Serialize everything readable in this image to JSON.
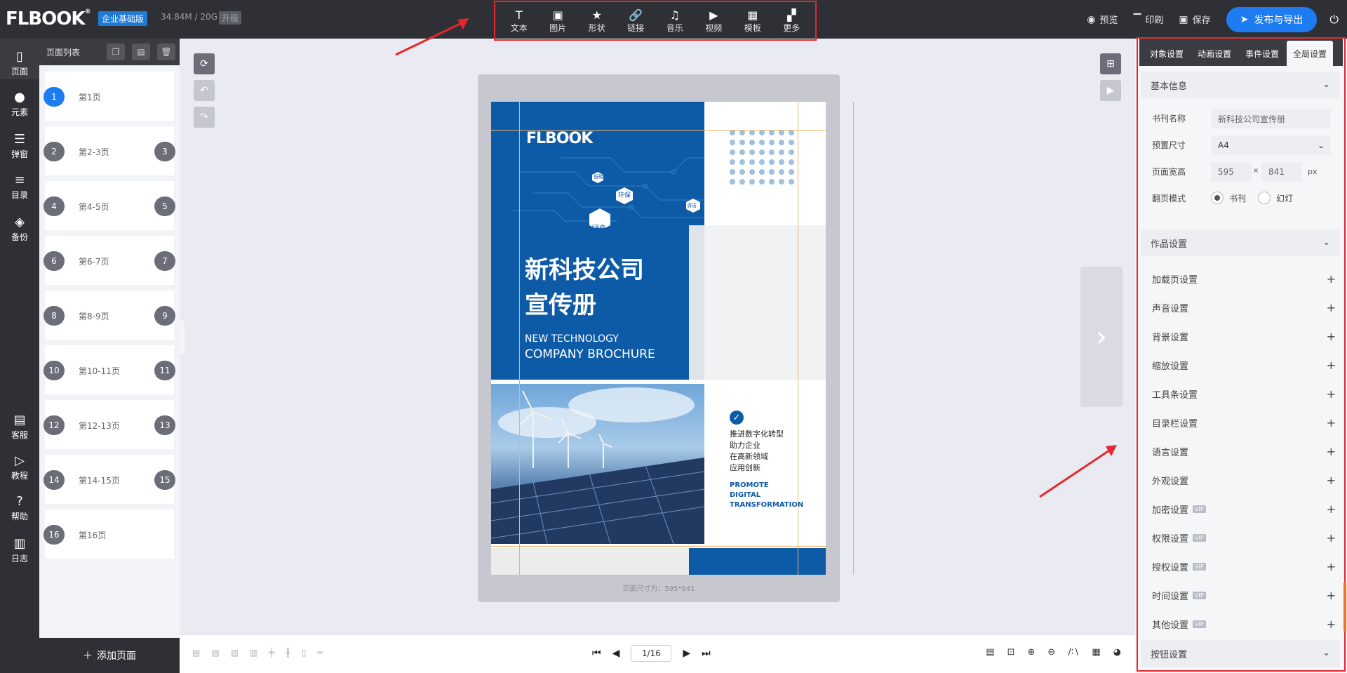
{
  "app": {
    "logo": "FLBOOK",
    "logo_mark": "®",
    "edition": "企业基础版",
    "quota": "34.84M / 20G",
    "upgrade": "升级"
  },
  "toolbar": [
    {
      "label": "文本",
      "icon": "text-icon",
      "glyph": "T"
    },
    {
      "label": "图片",
      "icon": "image-icon",
      "glyph": "▣"
    },
    {
      "label": "形状",
      "icon": "star-icon",
      "glyph": "★"
    },
    {
      "label": "链接",
      "icon": "link-icon",
      "glyph": "🔗"
    },
    {
      "label": "音乐",
      "icon": "music-icon",
      "glyph": "♫"
    },
    {
      "label": "视频",
      "icon": "video-icon",
      "glyph": "▶"
    },
    {
      "label": "模板",
      "icon": "template-icon",
      "glyph": "▦"
    },
    {
      "label": "更多",
      "icon": "more-icon",
      "glyph": "▞"
    }
  ],
  "top_actions": {
    "preview": "预览",
    "print": "印刷",
    "save": "保存",
    "publish": "发布与导出"
  },
  "leftnav": [
    {
      "label": "页面",
      "icon": "page-icon",
      "glyph": "▯"
    },
    {
      "label": "元素",
      "icon": "element-icon",
      "glyph": "●"
    },
    {
      "label": "弹窗",
      "icon": "popup-icon",
      "glyph": "☰"
    },
    {
      "label": "目录",
      "icon": "catalog-icon",
      "glyph": "≡"
    },
    {
      "label": "备份",
      "icon": "backup-icon",
      "glyph": "◈"
    },
    {
      "label": "客服",
      "icon": "service-icon",
      "glyph": "▤"
    },
    {
      "label": "教程",
      "icon": "tutorial-icon",
      "glyph": "▷"
    },
    {
      "label": "帮助",
      "icon": "help-icon",
      "glyph": "?"
    },
    {
      "label": "日志",
      "icon": "log-icon",
      "glyph": "▥"
    }
  ],
  "pagelist": {
    "title": "页面列表",
    "add_label": "添加页面",
    "pages": [
      {
        "label": "第1页",
        "left": "1",
        "right": ""
      },
      {
        "label": "第2-3页",
        "left": "2",
        "right": "3"
      },
      {
        "label": "第4-5页",
        "left": "4",
        "right": "5"
      },
      {
        "label": "第6-7页",
        "left": "6",
        "right": "7"
      },
      {
        "label": "第8-9页",
        "left": "8",
        "right": "9"
      },
      {
        "label": "第10-11页",
        "left": "10",
        "right": "11"
      },
      {
        "label": "第12-13页",
        "left": "12",
        "right": "13"
      },
      {
        "label": "第14-15页",
        "left": "14",
        "right": "15"
      },
      {
        "label": "第16页",
        "left": "16",
        "right": ""
      }
    ]
  },
  "page_content": {
    "logo": "FLBOOK",
    "tags": [
      "低碳",
      "环保",
      "绿色",
      "清洁"
    ],
    "title_line1": "新科技公司",
    "title_line2": "宣传册",
    "en_line1": "NEW TECHNOLOGY",
    "en_line2": "COMPANY BROCHURE",
    "body_lines": [
      "推进数字化转型",
      "助力企业",
      "在高新领域",
      "应用创新"
    ],
    "promo_lines": [
      "PROMOTE",
      "DIGITAL",
      "TRANSFORMATION"
    ]
  },
  "canvas": {
    "page_size": "页面尺寸为：595*841"
  },
  "pager": {
    "current": "1/16"
  },
  "right_panel": {
    "tabs": [
      "对象设置",
      "动画设置",
      "事件设置",
      "全局设置"
    ],
    "active_tab": "全局设置",
    "basic_info": {
      "title": "基本信息",
      "book_name_label": "书刊名称",
      "book_name": "新科技公司宣传册",
      "preset_label": "预置尺寸",
      "preset": "A4",
      "size_label": "页面宽高",
      "width": "595",
      "times": "×",
      "height": "841",
      "unit": "px",
      "flip_label": "翻页模式",
      "flip_options": [
        "书刊",
        "幻灯"
      ],
      "flip_selected": "书刊"
    },
    "work_settings_title": "作品设置",
    "settings": [
      {
        "label": "加载页设置",
        "vip": false
      },
      {
        "label": "声音设置",
        "vip": false
      },
      {
        "label": "背景设置",
        "vip": false
      },
      {
        "label": "缩放设置",
        "vip": false
      },
      {
        "label": "工具条设置",
        "vip": false
      },
      {
        "label": "目录栏设置",
        "vip": false
      },
      {
        "label": "语言设置",
        "vip": false
      },
      {
        "label": "外观设置",
        "vip": false
      },
      {
        "label": "加密设置",
        "vip": true
      },
      {
        "label": "权限设置",
        "vip": true
      },
      {
        "label": "授权设置",
        "vip": true
      },
      {
        "label": "时间设置",
        "vip": true
      },
      {
        "label": "其他设置",
        "vip": true
      }
    ],
    "vip_label": "VIP",
    "button_settings_title": "按钮设置"
  },
  "colors": {
    "accent": "#1e7cf2",
    "dark": "#2f3035",
    "highlight_border": "#e7262d",
    "brochure_blue": "#0d5aa7"
  }
}
